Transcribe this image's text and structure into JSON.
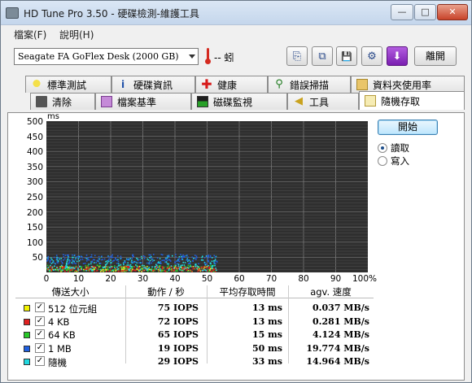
{
  "window": {
    "title": "HD Tune Pro 3.50 - 硬碟檢測-維護工具",
    "min": "—",
    "max": "□",
    "close": "✕"
  },
  "menu": [
    {
      "label": "檔案(F)"
    },
    {
      "label": "說明(H)"
    }
  ],
  "toolbar": {
    "drive": "Seagate FA GoFlex Desk (2000 GB)",
    "temperature": "-- 蚓",
    "exit_label": "離開",
    "buttons": [
      {
        "name": "copy-text-icon",
        "glyph": "⎘"
      },
      {
        "name": "copy-screenshot-icon",
        "glyph": "⧉"
      },
      {
        "name": "save-icon",
        "glyph": "💾"
      },
      {
        "name": "options-icon",
        "glyph": "⚙"
      },
      {
        "name": "download-icon",
        "glyph": "⬇"
      }
    ]
  },
  "tabs": {
    "row1": [
      {
        "label": "標準測試",
        "icon": "benchmark-icon"
      },
      {
        "label": "硬碟資訊",
        "icon": "info-icon"
      },
      {
        "label": "健康",
        "icon": "health-icon"
      },
      {
        "label": "錯誤掃描",
        "icon": "error-scan-icon"
      },
      {
        "label": "資料夾使用率",
        "icon": "folder-usage-icon"
      }
    ],
    "row2": [
      {
        "label": "清除",
        "icon": "erase-icon"
      },
      {
        "label": "檔案基準",
        "icon": "file-benchmark-icon"
      },
      {
        "label": "磁碟監視",
        "icon": "disk-monitor-icon"
      },
      {
        "label": "工具",
        "icon": "tools-icon"
      },
      {
        "label": "隨機存取",
        "icon": "random-access-icon",
        "active": true
      }
    ]
  },
  "controls": {
    "start": "開始",
    "read": "讀取",
    "write": "寫入",
    "mode": "read"
  },
  "chart_data": {
    "type": "scatter",
    "ylabel": "ms",
    "ylim": [
      0,
      500
    ],
    "xlim": [
      0,
      100
    ],
    "yticks": [
      "500",
      "450",
      "400",
      "350",
      "300",
      "250",
      "200",
      "150",
      "100",
      "50"
    ],
    "xticks": [
      "0",
      "10",
      "20",
      "30",
      "40",
      "50",
      "60",
      "70",
      "80",
      "90",
      "100%"
    ],
    "grid": true,
    "series": [
      {
        "name": "512 位元組",
        "color": "#e8e82a",
        "x_range": [
          0,
          53
        ],
        "y_range": [
          5,
          22
        ]
      },
      {
        "name": "4 KB",
        "color": "#e02020",
        "x_range": [
          0,
          53
        ],
        "y_range": [
          5,
          22
        ]
      },
      {
        "name": "64 KB",
        "color": "#28c828",
        "x_range": [
          0,
          53
        ],
        "y_range": [
          5,
          26
        ]
      },
      {
        "name": "1 MB",
        "color": "#2060e0",
        "x_range": [
          0,
          53
        ],
        "y_range": [
          30,
          62
        ]
      },
      {
        "name": "隨機",
        "color": "#20d8e0",
        "x_range": [
          0,
          53
        ],
        "y_range": [
          8,
          58
        ]
      }
    ]
  },
  "table": {
    "headers": [
      "傳送大小",
      "動作 / 秒",
      "平均存取時間",
      "agv. 速度"
    ],
    "rows": [
      {
        "label": "512 位元組",
        "color": "#f2f200",
        "ops": "75 IOPS",
        "access": "13 ms",
        "speed": "0.037 MB/s"
      },
      {
        "label": "4 KB",
        "color": "#e02020",
        "ops": "72 IOPS",
        "access": "13 ms",
        "speed": "0.281 MB/s"
      },
      {
        "label": "64 KB",
        "color": "#28c828",
        "ops": "65 IOPS",
        "access": "15 ms",
        "speed": "4.124 MB/s"
      },
      {
        "label": "1 MB",
        "color": "#2060e0",
        "ops": "19 IOPS",
        "access": "50 ms",
        "speed": "19.774 MB/s"
      },
      {
        "label": "隨機",
        "color": "#20d8e0",
        "ops": "29 IOPS",
        "access": "33 ms",
        "speed": "14.964 MB/s"
      }
    ]
  }
}
